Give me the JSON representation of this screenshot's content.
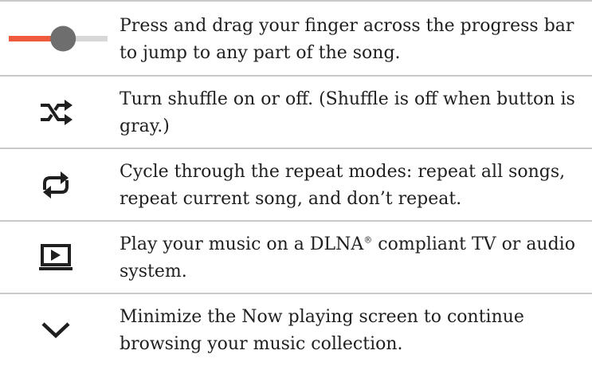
{
  "rows": [
    {
      "icon": "progress-slider-icon",
      "text": "Press and drag your finger across the progress bar to jump to any part of the song."
    },
    {
      "icon": "shuffle-icon",
      "text": "Turn shuffle on or off. (Shuffle is off when button is gray.)"
    },
    {
      "icon": "repeat-icon",
      "text": "Cycle through the repeat modes: repeat all songs, repeat current song, and don’t repeat."
    },
    {
      "icon": "dlna-play-icon",
      "text_before": "Play your music on a DLNA",
      "registered_mark": "®",
      "text_after": " compliant TV or audio system."
    },
    {
      "icon": "chevron-down-icon",
      "text": "Minimize the Now playing screen to continue browsing your music collection."
    }
  ],
  "progress_bar": {
    "fraction": 0.55,
    "played_color": "#f05a3c",
    "track_color": "#d7d7d7",
    "thumb_color": "#6e6e6e"
  },
  "icon_color": "#1f1f1f",
  "rule_color": "#c9c9c9"
}
